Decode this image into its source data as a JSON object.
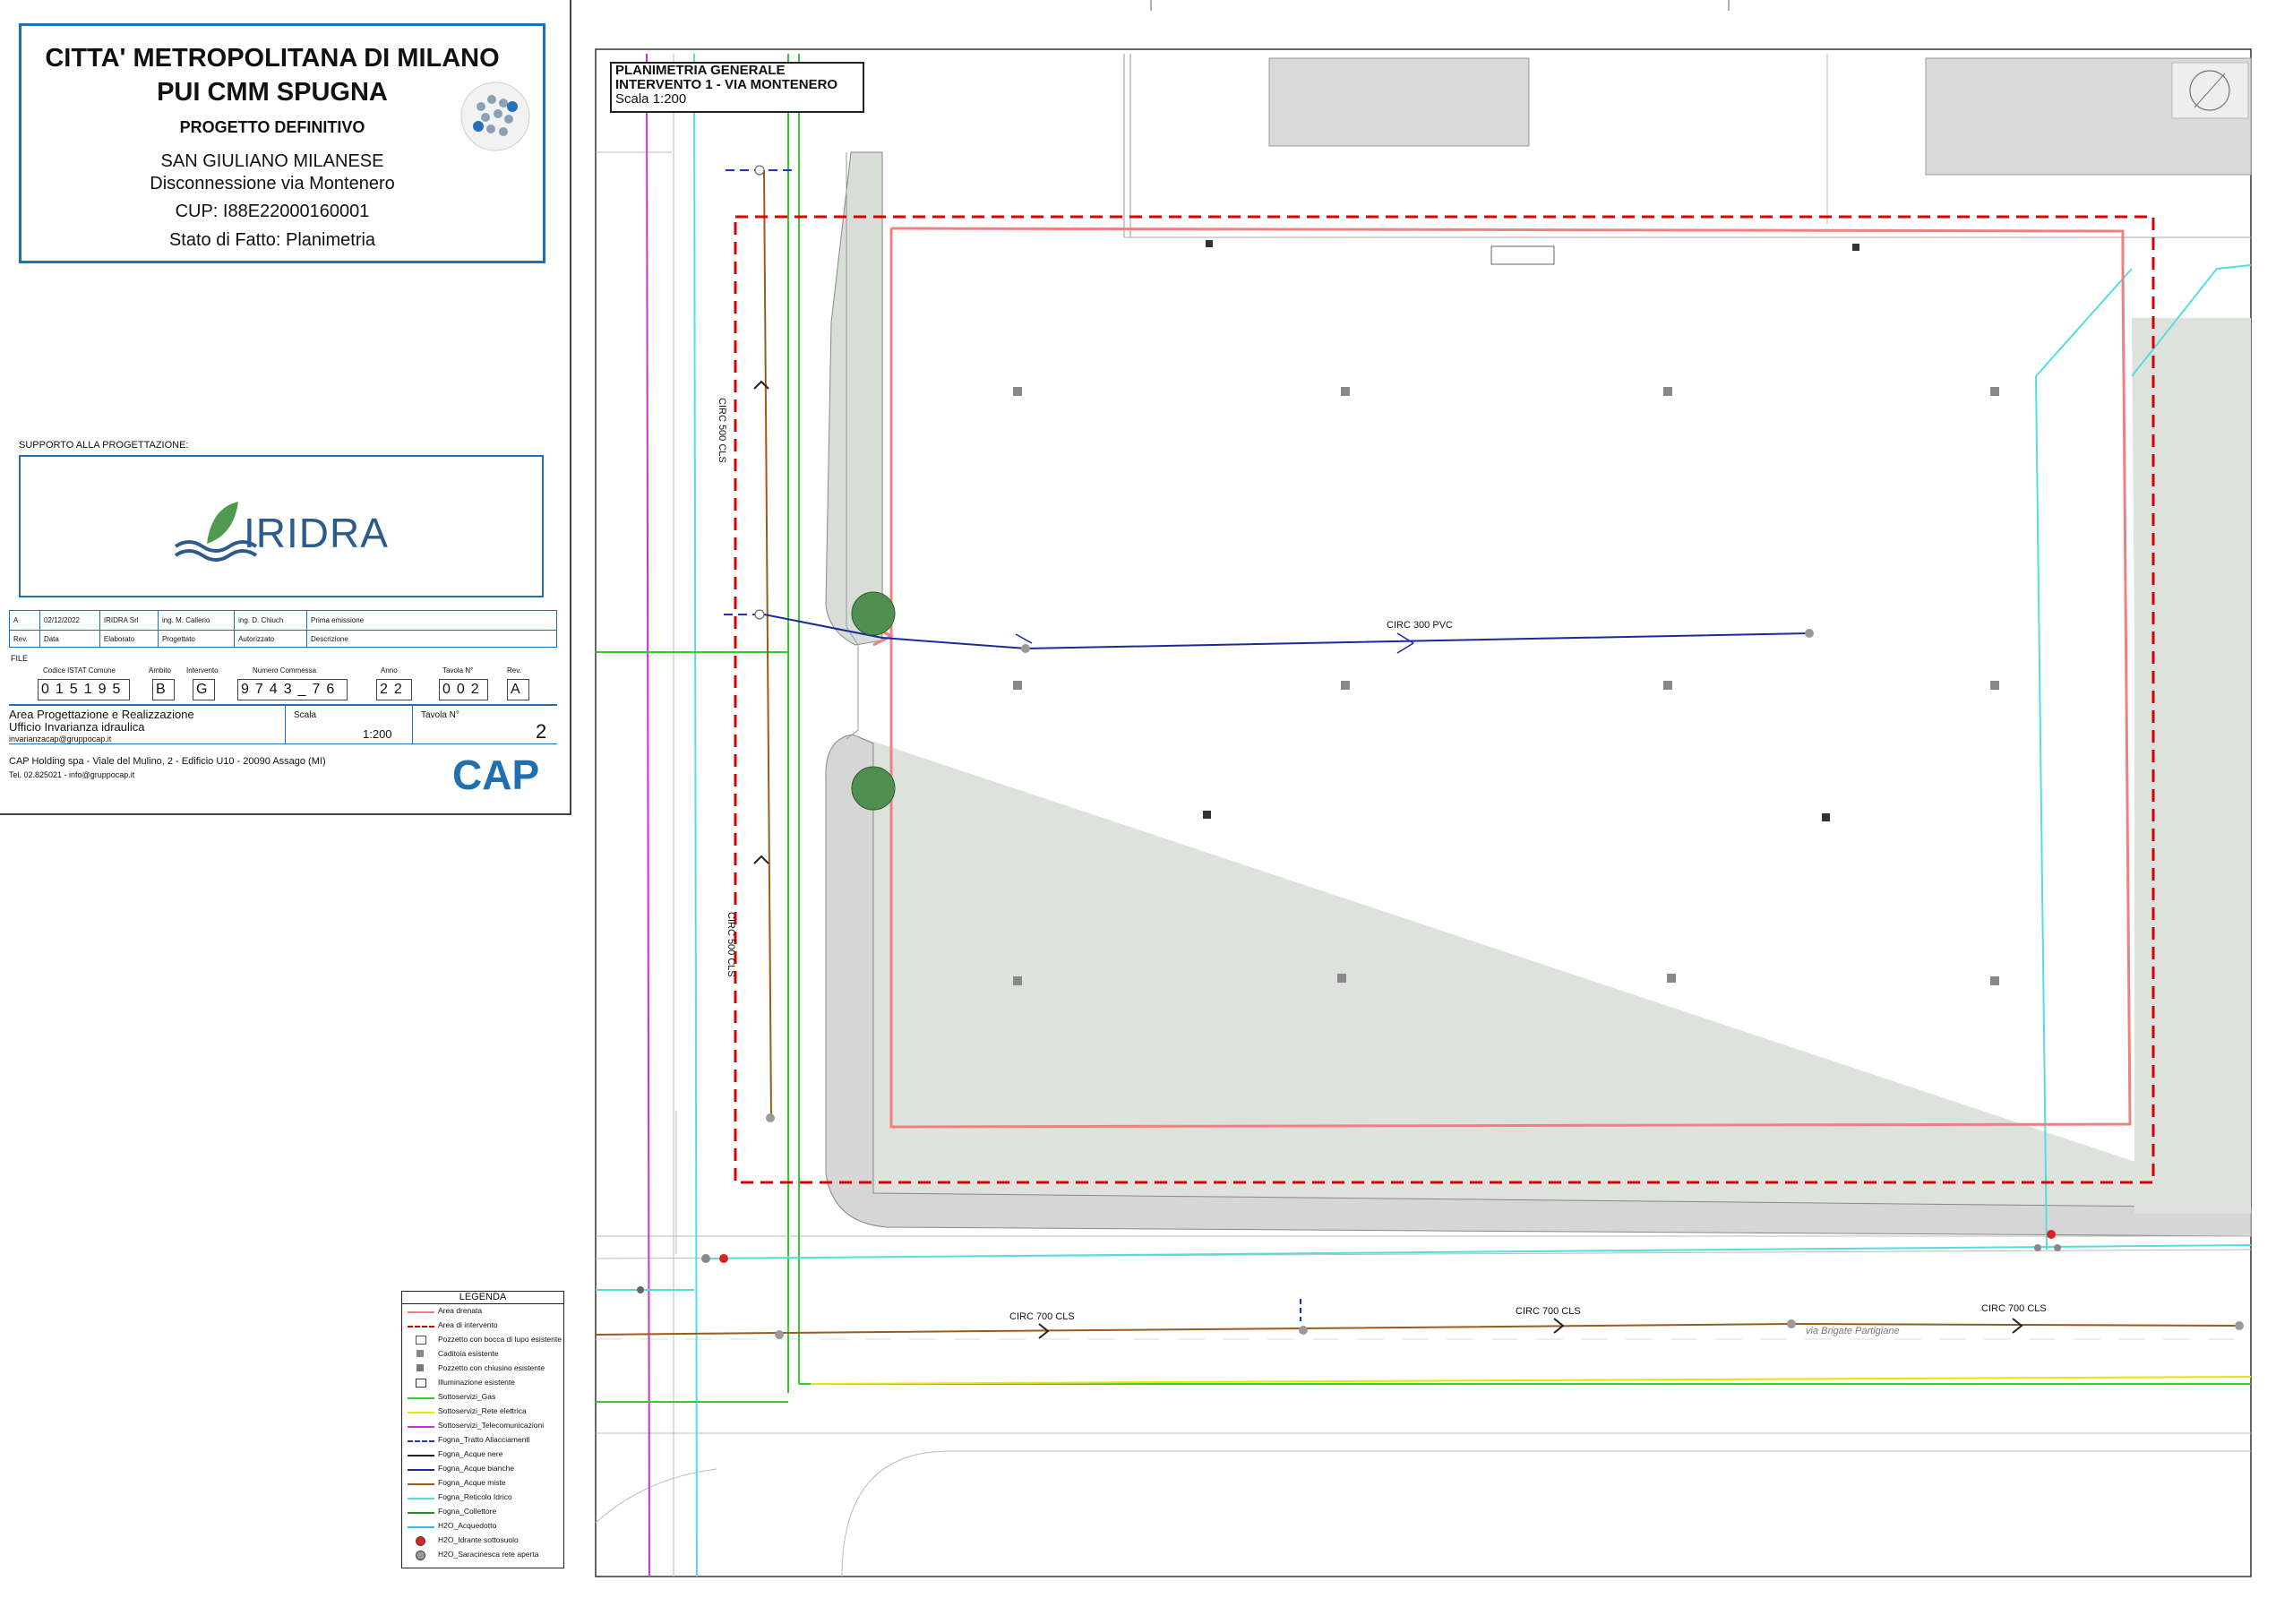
{
  "title_block": {
    "client": "CITTA' METROPOLITANA DI MILANO",
    "program": "PUI CMM SPUGNA",
    "phase": "PROGETTO DEFINITIVO",
    "municipality": "SAN GIULIANO MILANESE",
    "subject": "Disconnessione via Montenero",
    "cup": "CUP: I88E22000160001",
    "drawing_title": "Stato di Fatto: Planimetria",
    "support_label": "SUPPORTO ALLA PROGETTAZIONE:",
    "support_logo": "IRIDRA",
    "revision_row": [
      "A",
      "02/12/2022",
      "IRIDRA Srl",
      "ing. M. Callerio",
      "ing. D. Chiuch",
      "Prima emissione"
    ],
    "revision_header": [
      "Rev.",
      "Data",
      "Elaborato",
      "Progettato",
      "Autorizzato",
      "Descrizione"
    ],
    "file_label": "FILE",
    "code_labels": [
      "Codice ISTAT Comune",
      "Ambito",
      "Intervento",
      "Numero Commessa",
      "Anno",
      "Tavola N°",
      "Rev."
    ],
    "code_values": [
      "015195",
      "B",
      "G",
      "9743_76",
      "22",
      "002",
      "A"
    ],
    "office_title": "Area Progettazione e Realizzazione",
    "office_sub": "Ufficio Invarianza idraulica",
    "office_email": "invarianzacap@gruppocap.it",
    "scale_label": "Scala",
    "scale_value": "1:200",
    "sheet_label": "Tavola N°",
    "sheet_value": "2",
    "company": "CAP Holding spa - Viale del Mulino, 2 - Edificio U10 - 20090 Assago (MI)",
    "contacts": "Tel. 02.825021 - info@gruppocap.it",
    "cap_logo": "CAP"
  },
  "plan": {
    "title_1": "PLANIMETRIA GENERALE",
    "title_2": "INTERVENTO 1 - VIA MONTENERO",
    "scale": "Scala 1:200",
    "pipe_labels": {
      "circ_300": "CIRC 300 PVC",
      "circ_500_a": "CIRC 500 CLS",
      "circ_500_b": "CIRC 500 CLS",
      "circ_700_a": "CIRC 700 CLS",
      "circ_700_b": "CIRC 700 CLS",
      "circ_700_c": "CIRC 700 CLS"
    },
    "street": "via Brigate Partigiane"
  },
  "legend": {
    "title": "LEGENDA",
    "items": [
      {
        "label": "Area drenata",
        "color": "#f08080",
        "style": "solid"
      },
      {
        "label": "Area di intervento",
        "color": "#d80000",
        "style": "dashed"
      },
      {
        "label": "Pozzetto con bocca di lupo esistente",
        "color": "#555555",
        "style": "symbol"
      },
      {
        "label": "Caditoia esistente",
        "color": "#888888",
        "style": "square"
      },
      {
        "label": "Pozzetto con chiusino esistente",
        "color": "#777777",
        "style": "square"
      },
      {
        "label": "Illuminazione esistente",
        "color": "#333333",
        "style": "symbol"
      },
      {
        "label": "Sottoservizi_Gas",
        "color": "#33cc33",
        "style": "solid"
      },
      {
        "label": "Sottoservizi_Rete elettrica",
        "color": "#e6e600",
        "style": "solid"
      },
      {
        "label": "Sottoservizi_Telecomunicazioni",
        "color": "#cc33cc",
        "style": "solid"
      },
      {
        "label": "Fogna_Tratto Allacciamenti",
        "color": "#2233bb",
        "style": "dashed"
      },
      {
        "label": "Fogna_Acque nere",
        "color": "#222222",
        "style": "solid"
      },
      {
        "label": "Fogna_Acque bianche",
        "color": "#1a2a9a",
        "style": "solid"
      },
      {
        "label": "Fogna_Acque miste",
        "color": "#9a5a1a",
        "style": "solid"
      },
      {
        "label": "Fogna_Reticolo Idrico",
        "color": "#55dddd",
        "style": "solid"
      },
      {
        "label": "Fogna_Collettore",
        "color": "#338833",
        "style": "solid"
      },
      {
        "label": "H2O_Acquedotto",
        "color": "#33bbee",
        "style": "solid"
      },
      {
        "label": "H2O_Idrante sottosuolo",
        "color": "#dd2222",
        "style": "dot"
      },
      {
        "label": "H2O_Saracinesca rete aperta",
        "color": "#999999",
        "style": "dot"
      }
    ]
  }
}
